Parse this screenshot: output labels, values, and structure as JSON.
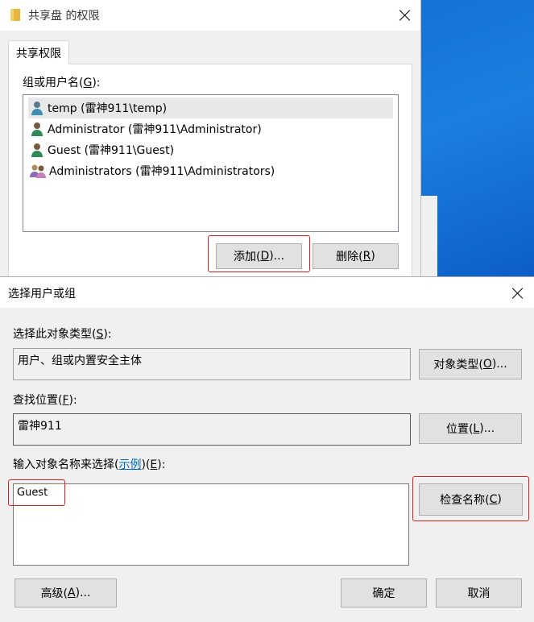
{
  "perm_window": {
    "title": "共享盘 的权限",
    "tab_label": "共享权限",
    "group_label_prefix": "组或用户名(",
    "group_label_key": "G",
    "group_label_suffix": "):",
    "users": [
      {
        "name": "temp (雷神911\\temp)",
        "icon": "user-icon"
      },
      {
        "name": "Administrator (雷神911\\Administrator)",
        "icon": "user-icon"
      },
      {
        "name": "Guest (雷神911\\Guest)",
        "icon": "user-icon"
      },
      {
        "name": "Administrators (雷神911\\Administrators)",
        "icon": "group-icon"
      }
    ],
    "add_prefix": "添加(",
    "add_key": "D",
    "add_suffix": ")...",
    "remove_prefix": "删除(",
    "remove_key": "R",
    "remove_suffix": ")"
  },
  "select_dialog": {
    "title": "选择用户或组",
    "object_type_label_prefix": "选择此对象类型(",
    "object_type_label_key": "S",
    "object_type_label_suffix": "):",
    "object_type_value": "用户、组或内置安全主体",
    "object_types_btn_prefix": "对象类型(",
    "object_types_btn_key": "O",
    "object_types_btn_suffix": ")...",
    "location_label_prefix": "查找位置(",
    "location_label_key": "F",
    "location_label_suffix": "):",
    "location_value": "雷神911",
    "location_btn_prefix": "位置(",
    "location_btn_key": "L",
    "location_btn_suffix": ")...",
    "names_label_prefix": "输入对象名称来选择(",
    "names_label_link": "示例",
    "names_label_mid": ")(",
    "names_label_key": "E",
    "names_label_suffix": "):",
    "names_value": "Guest",
    "check_names_prefix": "检查名称(",
    "check_names_key": "C",
    "check_names_suffix": ")",
    "advanced_prefix": "高级(",
    "advanced_key": "A",
    "advanced_suffix": ")...",
    "ok_label": "确定",
    "cancel_label": "取消"
  },
  "colors": {
    "highlight": "#e02020",
    "link": "#0066cc",
    "desktop": "#0a63c9"
  }
}
